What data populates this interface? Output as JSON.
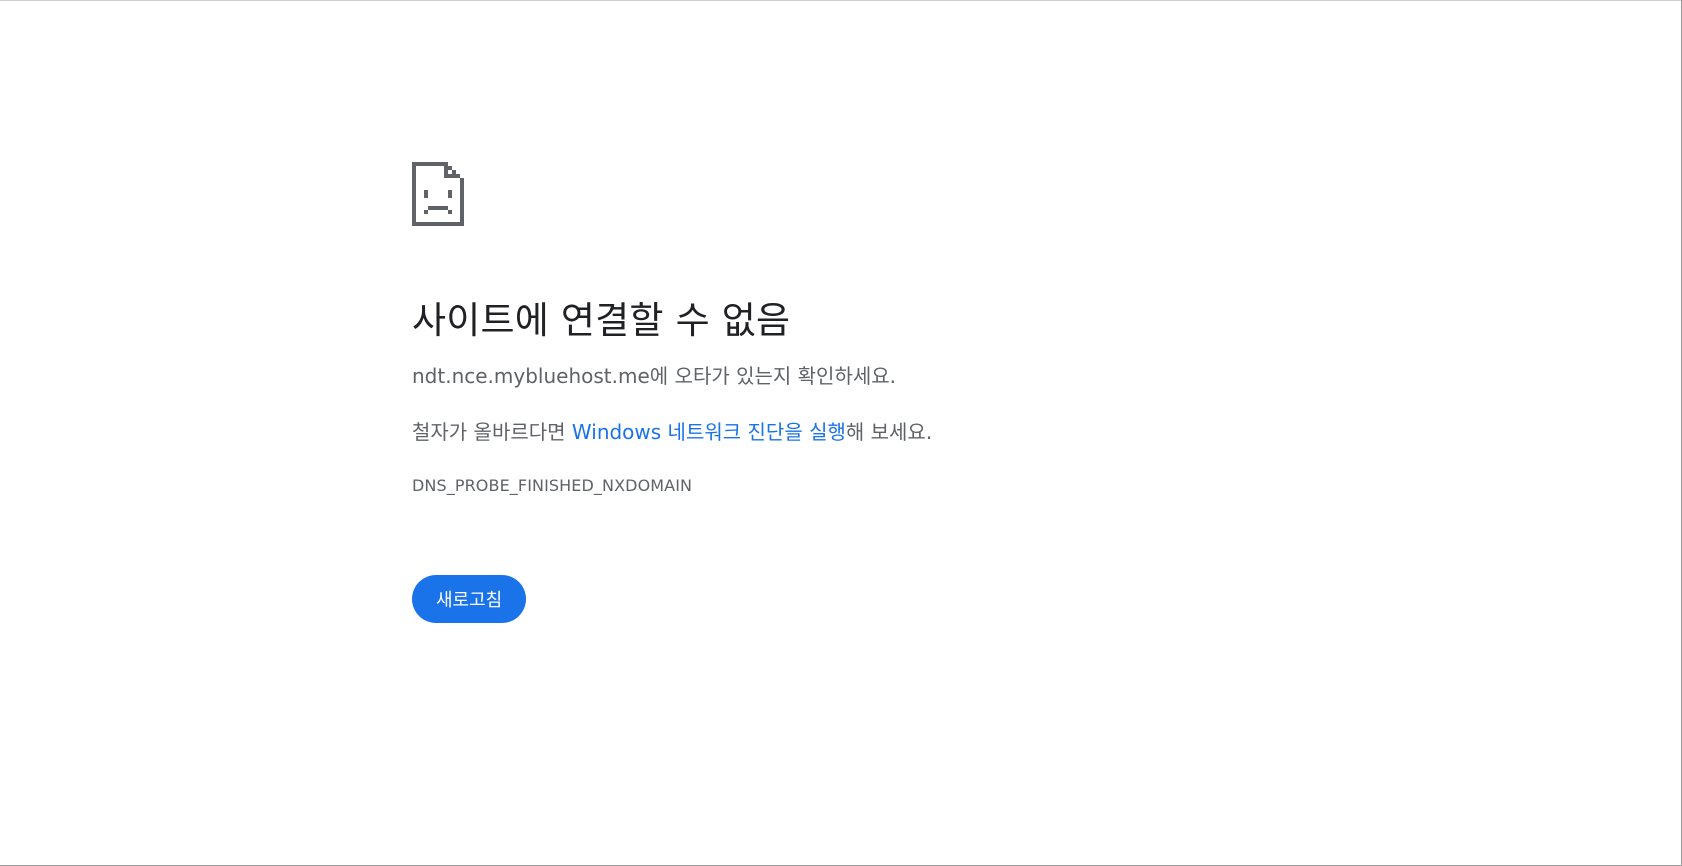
{
  "error_page": {
    "icon": "sad-document-icon",
    "title": "사이트에 연결할 수 없음",
    "host": "ndt.nce.mybluehost.me",
    "host_suffix": "에 오타가 있는지 확인하세요.",
    "suggestion_prefix": "철자가 올바르다면 ",
    "suggestion_link": "Windows 네트워크 진단을 실행",
    "suggestion_suffix": "해 보세요.",
    "error_code": "DNS_PROBE_FINISHED_NXDOMAIN",
    "reload_label": "새로고침"
  },
  "colors": {
    "accent": "#1a73e8",
    "title_text": "#202124",
    "body_text": "#5f6368",
    "icon": "#5f6368"
  }
}
